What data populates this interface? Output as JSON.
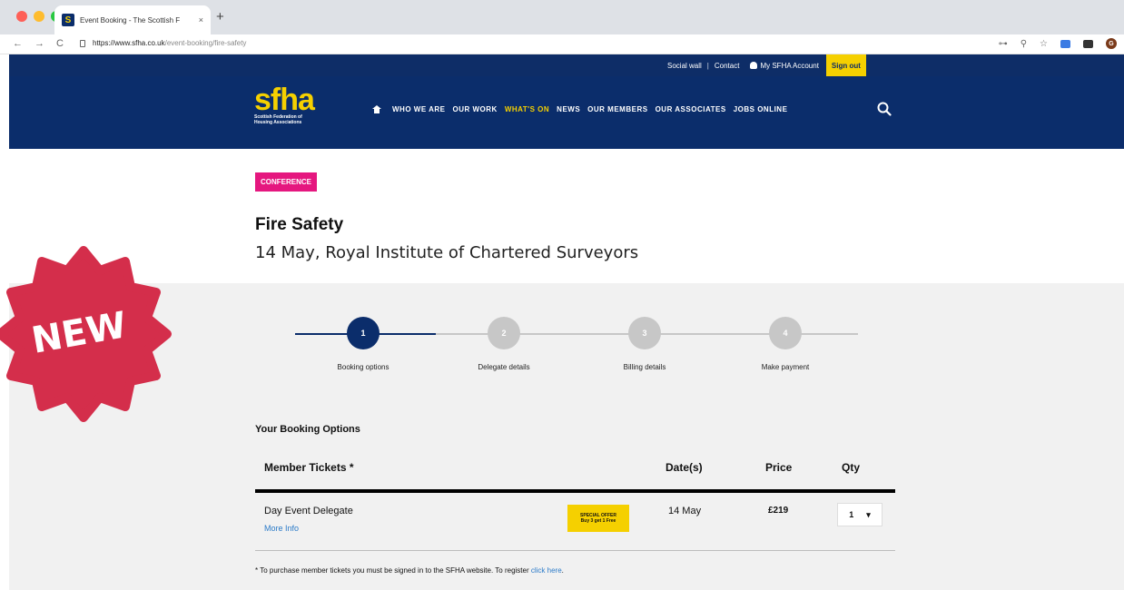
{
  "browser": {
    "tab_title": "Event Booking - The Scottish F",
    "tab_close": "×",
    "new_tab": "+",
    "favicon_letter": "S",
    "url_bold": "https://www.sfha.co.uk",
    "url_rest": "/event-booking/fire-safety",
    "back": "←",
    "forward": "→",
    "reload": "C",
    "key_icon": "⊶",
    "zoom_icon": "⚲",
    "star_icon": "☆",
    "avatar_letter": "G"
  },
  "site": {
    "top_links": {
      "social_wall": "Social wall",
      "separator": "|",
      "contact": "Contact",
      "account": "My SFHA Account",
      "sign_out": "Sign out"
    },
    "logo": {
      "text": "sfha",
      "line1": "Scottish Federation of",
      "line2": "Housing Associations"
    },
    "nav": {
      "who_we_are": "WHO WE ARE",
      "our_work": "OUR WORK",
      "whats_on": "WHAT'S ON",
      "news": "NEWS",
      "our_members": "OUR MEMBERS",
      "our_associates": "OUR ASSOCIATES",
      "jobs_online": "JOBS ONLINE"
    },
    "accent": "#f5d000",
    "navy": "#0b2d6b"
  },
  "event": {
    "badge": "CONFERENCE",
    "title": "Fire Safety",
    "subtitle": "14 May, Royal Institute of Chartered Surveyors",
    "badge_color": "#e5177f"
  },
  "steps": [
    {
      "number": "1",
      "label": "Booking options",
      "active": true
    },
    {
      "number": "2",
      "label": "Delegate details",
      "active": false
    },
    {
      "number": "3",
      "label": "Billing details",
      "active": false
    },
    {
      "number": "4",
      "label": "Make payment",
      "active": false
    }
  ],
  "booking": {
    "heading": "Your Booking Options",
    "columns": {
      "tickets": "Member Tickets *",
      "dates": "Date(s)",
      "price": "Price",
      "qty": "Qty"
    },
    "rows": [
      {
        "name": "Day Event Delegate",
        "more_info": "More Info",
        "offer_line1": "SPECIAL OFFER",
        "offer_line2": "Buy 3 get 1 Free",
        "date": "14 May",
        "price": "£219",
        "qty": "1",
        "qty_caret": "▾"
      }
    ],
    "footnote": "* To purchase member tickets you must be signed in to the SFHA website. To register",
    "footnote_link": "click here",
    "footnote_end": "."
  },
  "sticker": {
    "text": "NEW",
    "color": "#d42e4b"
  }
}
